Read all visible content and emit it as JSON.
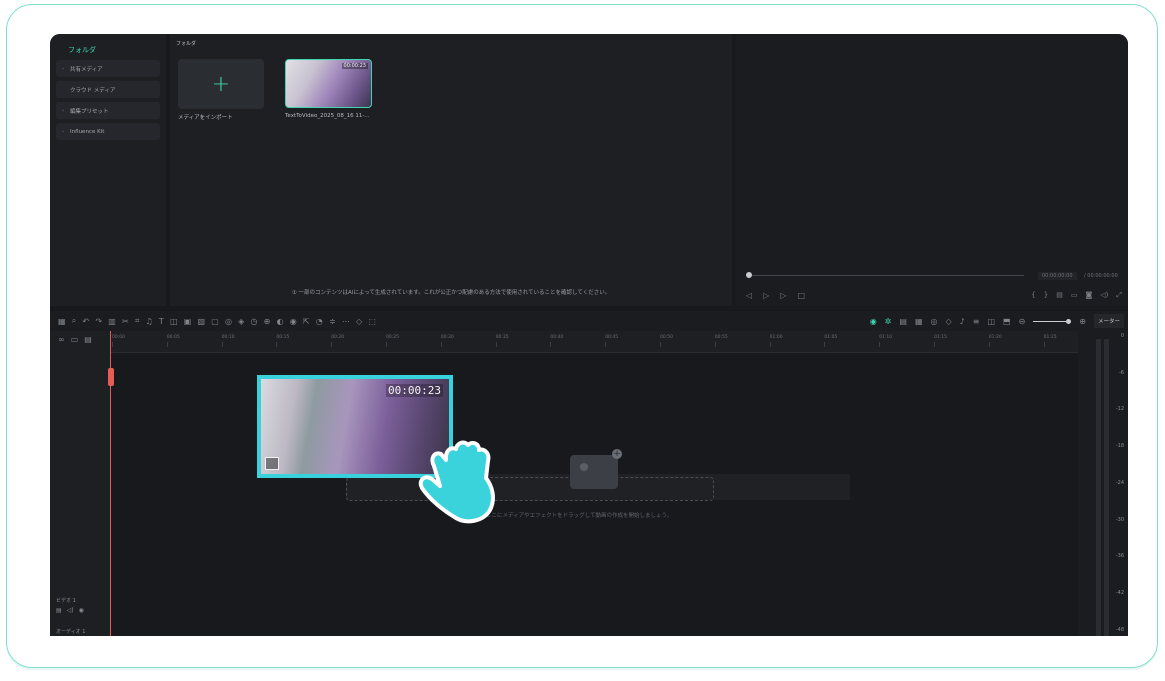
{
  "sidebar": {
    "header": "フォルダ",
    "items": [
      {
        "caret": "›",
        "label": "共有メディア"
      },
      {
        "caret": "",
        "label": "クラウド メディア"
      },
      {
        "caret": "›",
        "label": "編集プリセット"
      },
      {
        "caret": "›",
        "label": "Influence Kit"
      }
    ]
  },
  "media": {
    "header": "フォルダ",
    "import_label": "メディアをインポート",
    "import_plus": "+",
    "clip_label": "TextToVideo_2025_08_16 11-...",
    "clip_timecode": "00:00:23",
    "notice": "① 一部のコンテンツはAIによって生成されています。これが公正かつ配慮のある方法で使用されていることを確認してください。"
  },
  "preview": {
    "time_current": "00:00:00:00",
    "time_total": "/ 00:00:00:00"
  },
  "toolbar": {
    "meter_label": "メーター"
  },
  "ruler": {
    "ticks": [
      "00:00",
      "00:05",
      "00:10",
      "00:15",
      "00:20",
      "00:25",
      "00:30",
      "00:35",
      "00:40",
      "00:45",
      "00:50",
      "00:55",
      "01:00",
      "01:05",
      "01:10",
      "01:15",
      "01:20",
      "01:25"
    ]
  },
  "tracks": {
    "video_label": "ビデオ 1",
    "audio_label": "オーディオ 1"
  },
  "dropzone": {
    "text": "ここにメディアやエフェクトをドラッグして動画の作成を開始しましょう。"
  },
  "meter_labels": [
    "0",
    "-6",
    "-12",
    "-18",
    "-24",
    "-30",
    "-36",
    "-42",
    "-48"
  ],
  "drag_clip": {
    "timecode": "00:00:23"
  },
  "colors": {
    "accent": "#3fd6b0",
    "drag_border": "#39d2dc",
    "playhead": "#e55d55",
    "frame": "#7fe0cf"
  }
}
